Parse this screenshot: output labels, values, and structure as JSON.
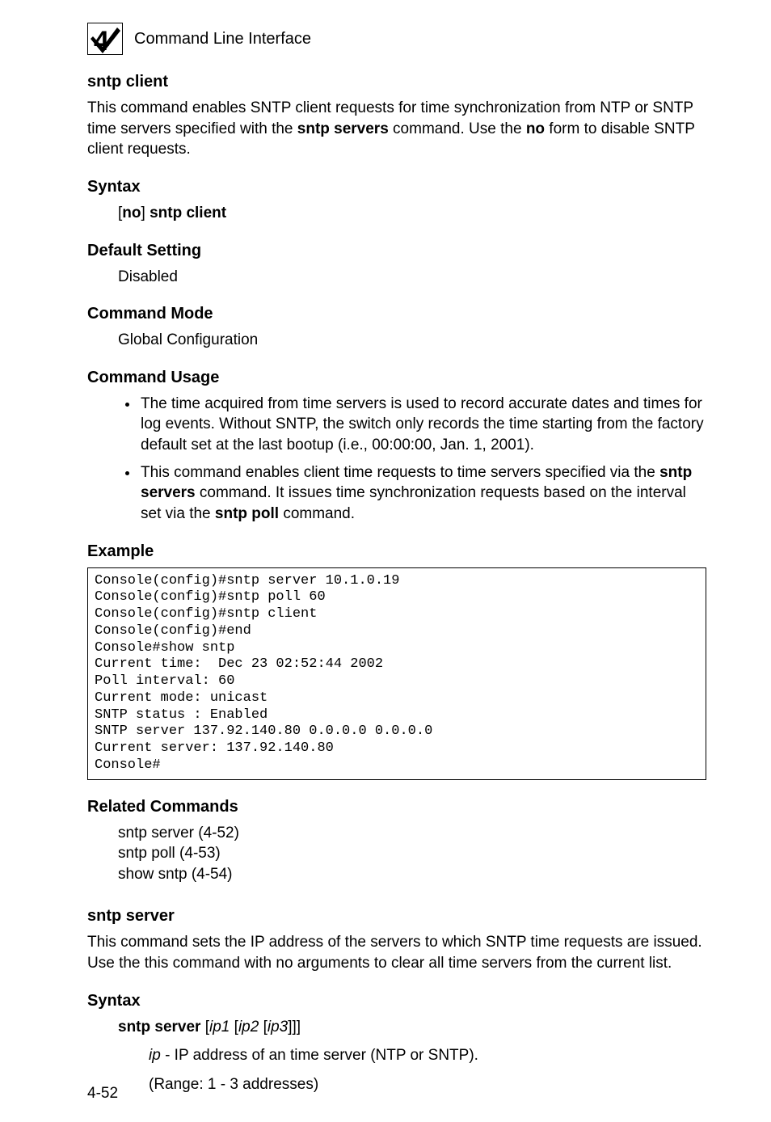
{
  "header": {
    "chapter_icon_alt": "chapter-4-icon",
    "running_head": "Command Line Interface"
  },
  "section1": {
    "title": "sntp client",
    "intro_parts": {
      "p1": "This command enables SNTP client requests for time synchronization from NTP or SNTP time servers specified with the ",
      "p2": "sntp servers",
      "p3": " command. Use the ",
      "p4": "no",
      "p5": " form to disable SNTP client requests."
    },
    "syntax": {
      "title": "Syntax",
      "line_parts": {
        "open_br": "[",
        "no": "no",
        "close_br": "] ",
        "cmd": "sntp client"
      }
    },
    "default": {
      "title": "Default Setting",
      "value": "Disabled"
    },
    "mode": {
      "title": "Command Mode",
      "value": "Global Configuration"
    },
    "usage": {
      "title": "Command Usage",
      "bullets": {
        "b1": "The time acquired from time servers is used to record accurate dates and times for log events. Without SNTP, the switch only records the time starting from the factory default set at the last bootup (i.e., 00:00:00, Jan. 1, 2001).",
        "b2_parts": {
          "p1": "This command enables client time requests to time servers specified via the ",
          "p2": "sntp servers",
          "p3": " command. It issues time synchronization requests based on the interval set via the ",
          "p4": "sntp poll",
          "p5": " command."
        }
      }
    },
    "example": {
      "title": "Example",
      "code": "Console(config)#sntp server 10.1.0.19\nConsole(config)#sntp poll 60\nConsole(config)#sntp client\nConsole(config)#end\nConsole#show sntp\nCurrent time:  Dec 23 02:52:44 2002\nPoll interval: 60\nCurrent mode: unicast\nSNTP status : Enabled\nSNTP server 137.92.140.80 0.0.0.0 0.0.0.0\nCurrent server: 137.92.140.80\nConsole#"
    },
    "related": {
      "title": "Related Commands",
      "lines": {
        "l1": "sntp server (4-52)",
        "l2": "sntp poll (4-53)",
        "l3": "show sntp (4-54)"
      }
    }
  },
  "section2": {
    "title": "sntp server",
    "intro": "This command sets the IP address of the servers to which SNTP time requests are issued. Use the this command with no arguments to clear all time servers from the current list.",
    "syntax": {
      "title": "Syntax",
      "line_parts": {
        "cmd": "sntp server",
        "sp1": " [",
        "ip1": "ip1",
        "sp2": " [",
        "ip2": "ip2",
        "sp3": " [",
        "ip3": "ip3",
        "end": "]]]"
      },
      "desc_parts": {
        "p1": "ip",
        "p2": " - IP address of an time server (NTP or SNTP)."
      },
      "range": "(Range: 1 - 3 addresses)"
    }
  },
  "page_number": "4-52"
}
